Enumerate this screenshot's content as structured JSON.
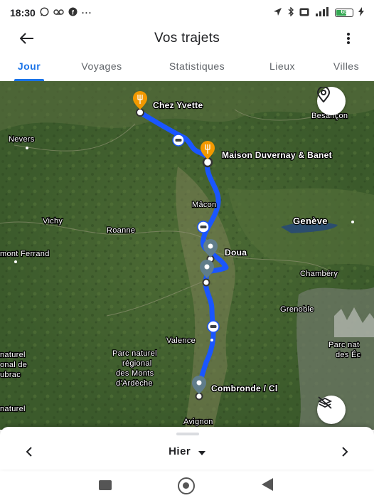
{
  "status_bar": {
    "time": "18:30",
    "battery": "65",
    "left_icons": [
      "whatsapp-icon",
      "voicemail-icon",
      "facebook-icon",
      "more-dots-icon"
    ],
    "right_icons": [
      "location-arrow-icon",
      "bluetooth-icon",
      "volte-icon",
      "signal-icon",
      "battery-icon",
      "charging-icon"
    ]
  },
  "app_bar": {
    "title": "Vos trajets"
  },
  "tabs": [
    {
      "label": "Jour",
      "active": true
    },
    {
      "label": "Voyages",
      "active": false
    },
    {
      "label": "Statistiques",
      "active": false
    },
    {
      "label": "Lieux",
      "active": false
    },
    {
      "label": "Villes",
      "active": false
    }
  ],
  "map": {
    "route_color": "#1a56ff",
    "restaurant_color": "#f29900",
    "stop_color": "#607d8b",
    "stops": [
      {
        "name": "Chez Yvette",
        "type": "restaurant"
      },
      {
        "name": "Maison Duvernay & Banet",
        "type": "restaurant"
      },
      {
        "name": "Doua",
        "type": "place"
      },
      {
        "name": "Combronde / Cl",
        "type": "place"
      }
    ],
    "places": {
      "besancon": "Besançon",
      "nevers": "Nevers",
      "macon": "Mâcon",
      "geneve": "Genève",
      "vichy": "Vichy",
      "roanne": "Roanne",
      "clermont": "mont Ferrand",
      "chambery": "Chambéry",
      "grenoble": "Grenoble",
      "valence": "Valence",
      "parc_ardeche_1": "Parc naturel",
      "parc_ardeche_2": "régional",
      "parc_ardeche_3": "des Monts",
      "parc_ardeche_4": "d'Ardèche",
      "parc_left_1": "naturel",
      "parc_left_2": "onal de",
      "parc_left_3": "ubrac",
      "parc_left_4": "naturel",
      "parc_right_1": "Parc nat",
      "parc_right_2": "des Éc",
      "avignon": "Avignon"
    }
  },
  "bottom_bar": {
    "day": "Hier"
  }
}
